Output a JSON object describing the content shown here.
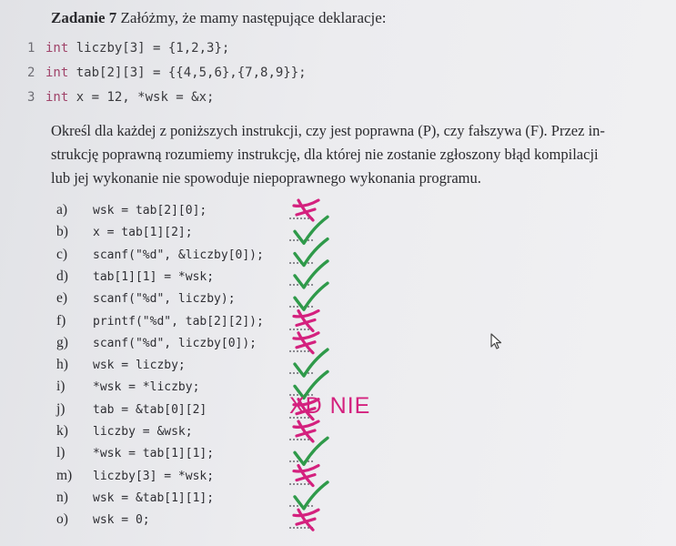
{
  "task": {
    "number": "Zadanie 7",
    "intro": "Załóżmy, że mamy następujące deklaracje:"
  },
  "code_lines": [
    {
      "num": "1",
      "kw": "int",
      "rest": " liczby[3] = {1,2,3};"
    },
    {
      "num": "2",
      "kw": "int",
      "rest": " tab[2][3] = {{4,5,6},{7,8,9}};"
    },
    {
      "num": "3",
      "kw": "int",
      "rest": " x = 12, *wsk = &x;"
    }
  ],
  "paragraph_lines": [
    "Określ dla każdej z poniższych instrukcji, czy jest poprawna (P), czy fałszywa (F). Przez in-",
    "strukcję poprawną rozumiemy instrukcję, dla której nie zostanie zgłoszony błąd kompilacji",
    "lub jej wykonanie nie spowoduje niepoprawnego wykonania programu."
  ],
  "items": [
    {
      "label": "a)",
      "expr": "wsk = tab[2][0];",
      "mark": "x"
    },
    {
      "label": "b)",
      "expr": "x = tab[1][2];",
      "mark": "v"
    },
    {
      "label": "c)",
      "expr": "scanf(\"%d\", &liczby[0]);",
      "mark": "v"
    },
    {
      "label": "d)",
      "expr": "tab[1][1] = *wsk;",
      "mark": "v"
    },
    {
      "label": "e)",
      "expr": "scanf(\"%d\", liczby);",
      "mark": "v"
    },
    {
      "label": "f)",
      "expr": "printf(\"%d\", tab[2][2]);",
      "mark": "x"
    },
    {
      "label": "g)",
      "expr": "scanf(\"%d\", liczby[0]);",
      "mark": "x"
    },
    {
      "label": "h)",
      "expr": "wsk = liczby;",
      "mark": "v"
    },
    {
      "label": "i)",
      "expr": "*wsk = *liczby;",
      "mark": "v"
    },
    {
      "label": "j)",
      "expr": "tab = &tab[0][2]",
      "mark": "x"
    },
    {
      "label": "k)",
      "expr": "liczby = &wsk;",
      "mark": "x"
    },
    {
      "label": "l)",
      "expr": "*wsk = tab[1][1];",
      "mark": "v"
    },
    {
      "label": "m)",
      "expr": "liczby[3] = *wsk;",
      "mark": "x"
    },
    {
      "label": "n)",
      "expr": "wsk = &tab[1][1];",
      "mark": "v"
    },
    {
      "label": "o)",
      "expr": "wsk = 0;",
      "mark": "x"
    }
  ],
  "handwritten_note": "XD NIE",
  "colors": {
    "x_mark": "#d4217e",
    "check_mark": "#2f9a4a"
  }
}
